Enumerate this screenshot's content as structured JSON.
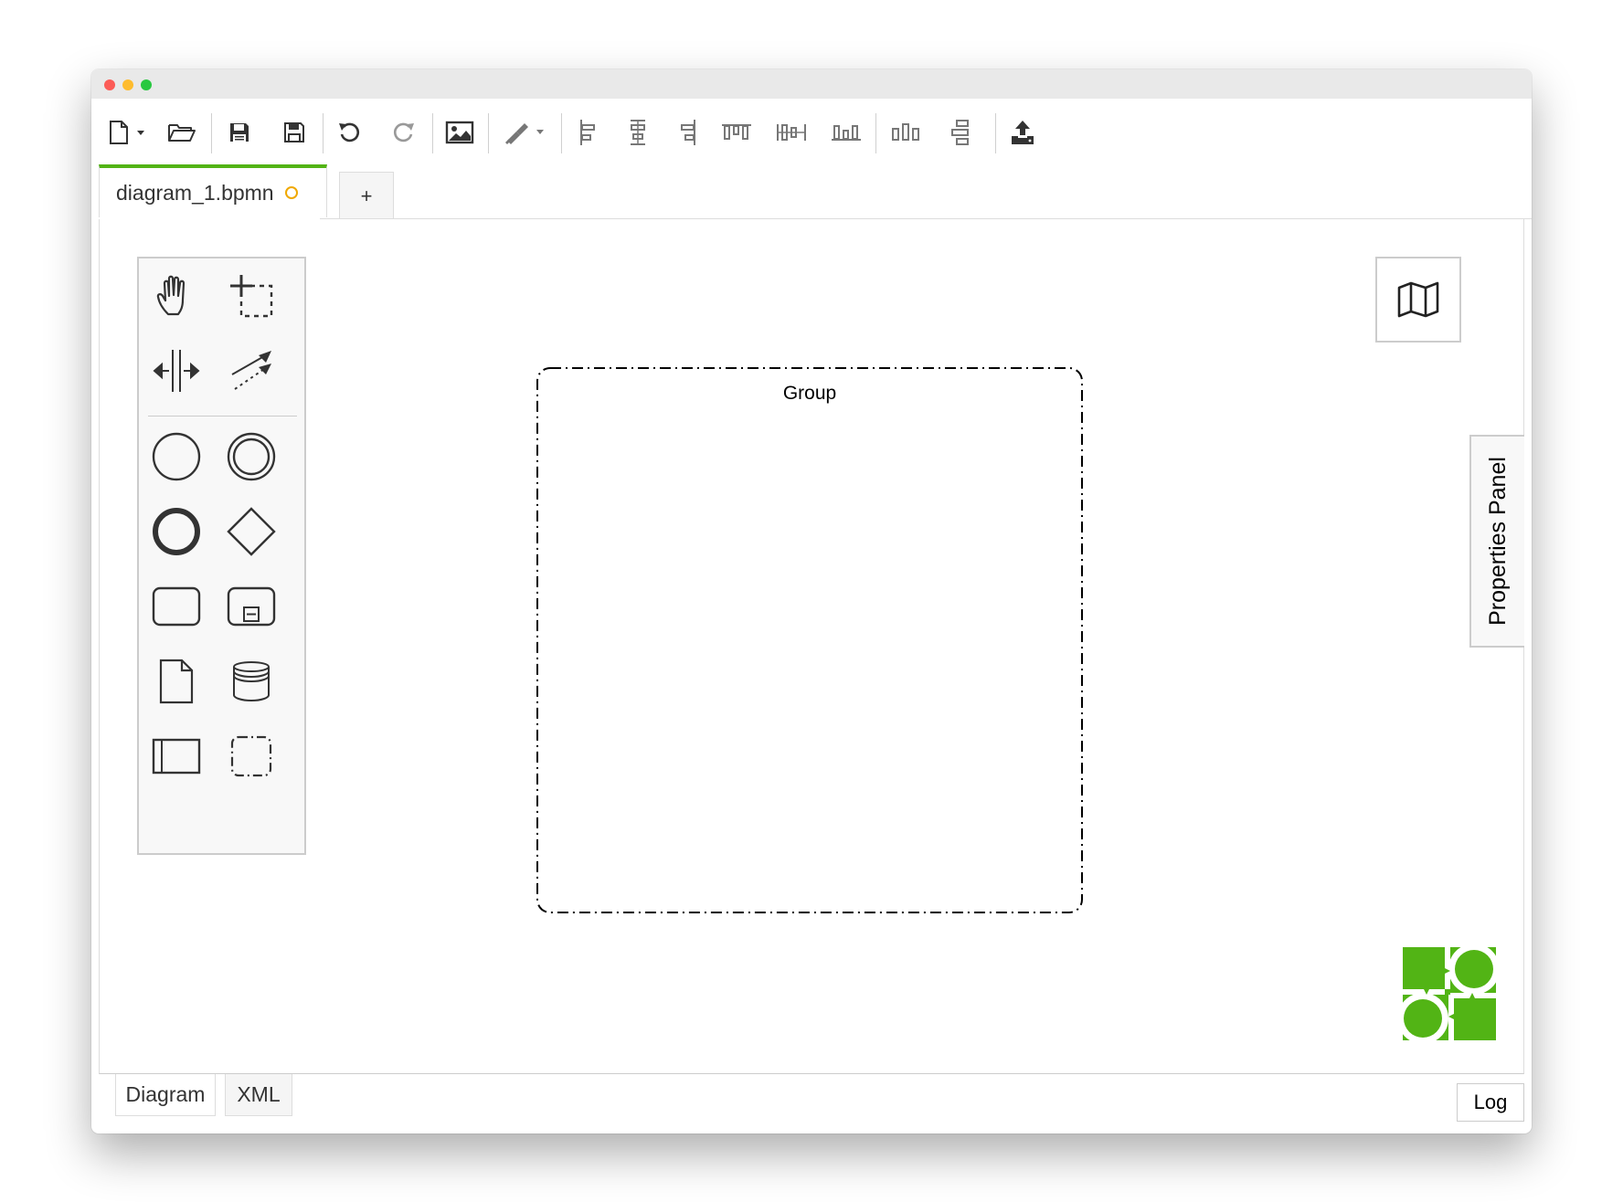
{
  "window": {
    "controls": [
      "close-icon",
      "minimize-icon",
      "zoom-icon"
    ]
  },
  "toolbar": {
    "buttons": [
      {
        "name": "new-file-dropdown",
        "icon": "new-file-icon"
      },
      {
        "name": "open-file",
        "icon": "folder-open-icon"
      },
      {
        "name": "save",
        "icon": "floppy-disk-icon"
      },
      {
        "name": "save-as",
        "icon": "floppy-disk-outline-icon"
      },
      {
        "name": "undo",
        "icon": "undo-icon"
      },
      {
        "name": "redo",
        "icon": "redo-icon"
      },
      {
        "name": "export-image",
        "icon": "image-icon"
      },
      {
        "name": "edit-color-dropdown",
        "icon": "paint-brush-icon"
      },
      {
        "name": "align-left",
        "icon": "align-left-icon"
      },
      {
        "name": "align-center",
        "icon": "align-center-icon"
      },
      {
        "name": "align-right",
        "icon": "align-right-icon"
      },
      {
        "name": "align-top",
        "icon": "align-top-icon"
      },
      {
        "name": "align-middle",
        "icon": "align-middle-icon"
      },
      {
        "name": "align-bottom",
        "icon": "align-bottom-icon"
      },
      {
        "name": "distribute-horizontal",
        "icon": "distribute-horizontal-icon"
      },
      {
        "name": "distribute-vertical",
        "icon": "distribute-vertical-icon"
      },
      {
        "name": "deploy",
        "icon": "deploy-upload-icon"
      }
    ]
  },
  "tabs": {
    "active_file": "diagram_1.bpmn",
    "add_label": "+"
  },
  "palette": {
    "tools": [
      "hand-tool-icon",
      "lasso-tool-icon",
      "space-tool-icon",
      "connection-tool-icon"
    ],
    "shapes": [
      "start-event-icon",
      "intermediate-event-icon",
      "end-event-icon",
      "gateway-icon",
      "task-icon",
      "subprocess-icon",
      "data-object-icon",
      "data-store-icon",
      "participant-icon",
      "group-icon"
    ]
  },
  "diagram": {
    "group_label": "Group"
  },
  "side": {
    "properties_label": "Properties Panel",
    "minimap_icon": "map-icon"
  },
  "bottom": {
    "tabs": [
      "Diagram",
      "XML"
    ],
    "log_label": "Log"
  },
  "colors": {
    "accent": "#52b415",
    "dirty": "#f0a800",
    "logo": "#52b415"
  }
}
